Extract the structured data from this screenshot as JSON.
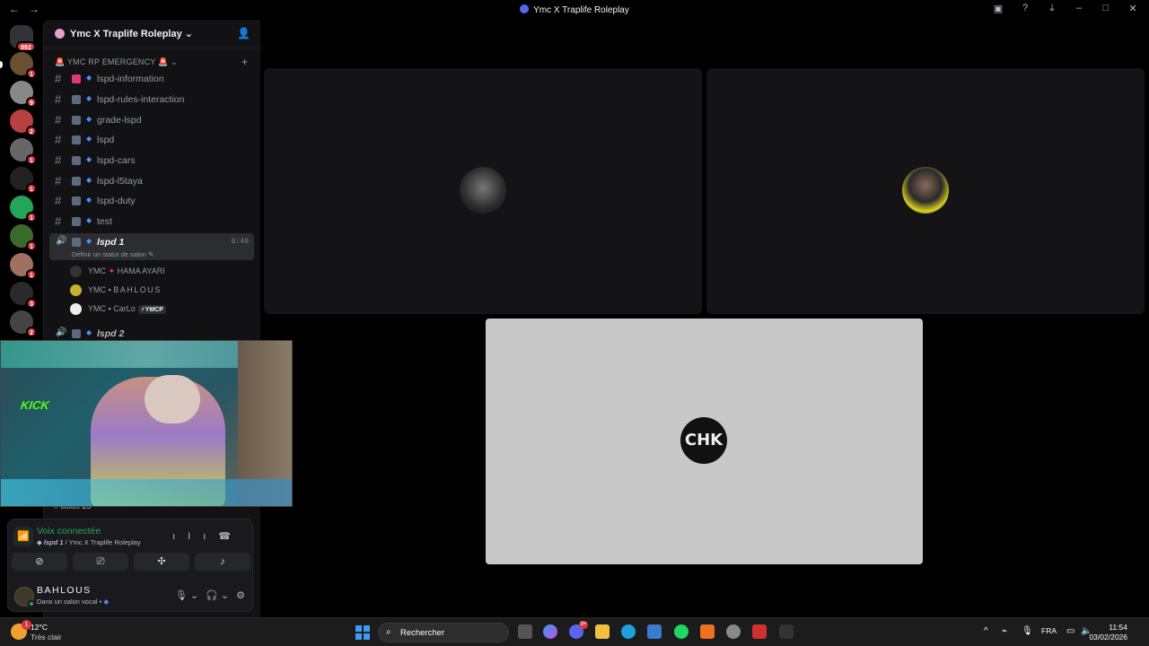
{
  "window": {
    "title": "Ymc X Traplife Roleplay",
    "nav_back": "←",
    "nav_forward": "→"
  },
  "rail": {
    "home_badge": "892",
    "servers": [
      {
        "badge": "1"
      },
      {
        "badge": "9"
      },
      {
        "badge": "2"
      },
      {
        "badge": "1"
      },
      {
        "badge": "1"
      },
      {
        "badge": "1"
      },
      {
        "badge": "1"
      },
      {
        "badge": "1"
      },
      {
        "badge": "3"
      },
      {
        "badge": "2"
      }
    ]
  },
  "server": {
    "name": "Ymc X Traplife Roleplay",
    "chevron": "⌄",
    "category": "YMC RP EMERGENCY",
    "category_prefix": "🚨",
    "category_suffix": "🚨",
    "add": "+"
  },
  "channels": [
    {
      "name": "lspd-information"
    },
    {
      "name": "lspd-rules-interaction"
    },
    {
      "name": "grade-lspd"
    },
    {
      "name": "lspd"
    },
    {
      "name": "lspd-cars"
    },
    {
      "name": "lspd-l5taya"
    },
    {
      "name": "lspd-duty"
    },
    {
      "name": "test"
    }
  ],
  "voice_channel": {
    "name": "lspd 1",
    "time": "6:46",
    "status": "Définir un statut de salon",
    "users": [
      {
        "prefix": "YMC",
        "sep": "✦",
        "name": "HAMA AYARI",
        "tag": ""
      },
      {
        "prefix": "YMC",
        "sep": "▪",
        "name": "BAHLOUS",
        "tag": ""
      },
      {
        "prefix": "YMC",
        "sep": "▪",
        "name": "CarLo",
        "tag": "⚡YMCP"
      }
    ]
  },
  "voice_channel_2": {
    "name": "lspd 2"
  },
  "peek_channel": "ticket-25",
  "voice_panel": {
    "title": "Voix connectée",
    "channel": "lspd 1",
    "server": " / Ymc X Traplife Roleplay",
    "buttons": [
      "camera-off",
      "screen-share",
      "activities",
      "soundboard"
    ]
  },
  "user": {
    "name": "BAHLOUS",
    "status": "Dans un salon vocal •"
  },
  "stage": {
    "tile3_label": "CHK"
  },
  "taskbar": {
    "temp": "12°C",
    "weather": "Très clair",
    "weather_badge": "1",
    "search": "Rechercher",
    "discord_badge": "9+",
    "lang": "FRA",
    "time": "11:54",
    "date": "03/02/2026"
  }
}
